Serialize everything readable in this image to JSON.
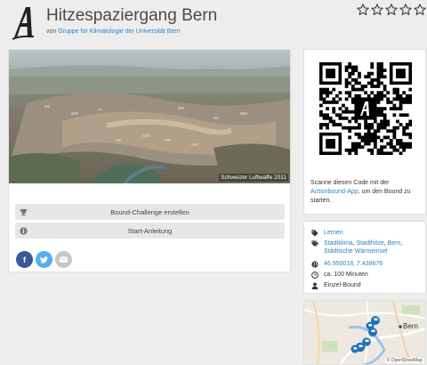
{
  "header": {
    "title": "Hitzespaziergang Bern",
    "by_prefix": "von",
    "author": "Gruppe für Klimatologie der Universität Bern",
    "rating": 0,
    "rating_max": 5
  },
  "main": {
    "photo_credit": "Schweizer Luftwaffe 2011",
    "challenge_button": "Bound-Challenge erstellen",
    "guide_button": "Start-Anleitung",
    "share": [
      "f",
      "t",
      "mail"
    ]
  },
  "qr": {
    "text_before": "Scanne diesen Code mit der",
    "app_link": "Actionbound-App",
    "text_after": ", um den Bound zu starten."
  },
  "info": {
    "category": "Lernen",
    "tags": [
      "Stadtklima",
      "Stadthitze",
      "Bern",
      "Städtische Wärmeinsel"
    ],
    "coordinates": "46.950018, 7.438676",
    "duration": "ca. 100 Minuten",
    "mode": "Einzel-Bound"
  },
  "map": {
    "place_label": "Bern",
    "credit": "© OpenStreetMap"
  },
  "colors": {
    "link": "#2a84c6",
    "facebook": "#3b5998",
    "twitter": "#55acee",
    "mail": "#c7c7c7",
    "pin": "#1e73b8"
  }
}
